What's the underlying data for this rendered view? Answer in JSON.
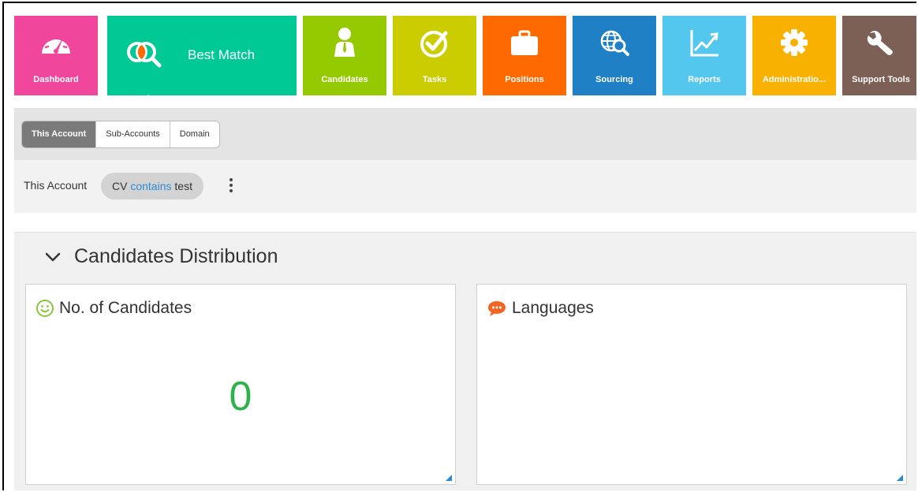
{
  "nav": {
    "items": [
      {
        "label": "Dashboard",
        "icon": "speedometer-icon",
        "color": "#f0479d"
      },
      {
        "label": "Best Match",
        "icon": "best-match-icon",
        "color": "#00c995"
      },
      {
        "label": "Candidates",
        "icon": "person-icon",
        "color": "#95c900"
      },
      {
        "label": "Tasks",
        "icon": "checkmark-circle-icon",
        "color": "#cbcd00"
      },
      {
        "label": "Positions",
        "icon": "briefcase-icon",
        "color": "#ff6a00"
      },
      {
        "label": "Sourcing",
        "icon": "globe-search-icon",
        "color": "#1f80c6"
      },
      {
        "label": "Reports",
        "icon": "line-chart-icon",
        "color": "#54c7ef"
      },
      {
        "label": "Administratio...",
        "icon": "gear-icon",
        "color": "#f8b100"
      },
      {
        "label": "Support Tools",
        "icon": "wrench-icon",
        "color": "#7c5f55"
      }
    ]
  },
  "tabs": [
    "This Account",
    "Sub-Accounts",
    "Domain"
  ],
  "filter": {
    "scope": "This Account",
    "field": "CV",
    "operator": "contains",
    "value": "test"
  },
  "panel": {
    "title": "Candidates Distribution",
    "cards": {
      "count": {
        "title": "No. of Candidates",
        "value": "0"
      },
      "languages": {
        "title": "Languages"
      }
    }
  },
  "colors": {
    "count_value": "#2fb24c",
    "operator": "#2b8ad6",
    "smiley": "#8cc63f",
    "speech_bubble": "#f26522"
  }
}
